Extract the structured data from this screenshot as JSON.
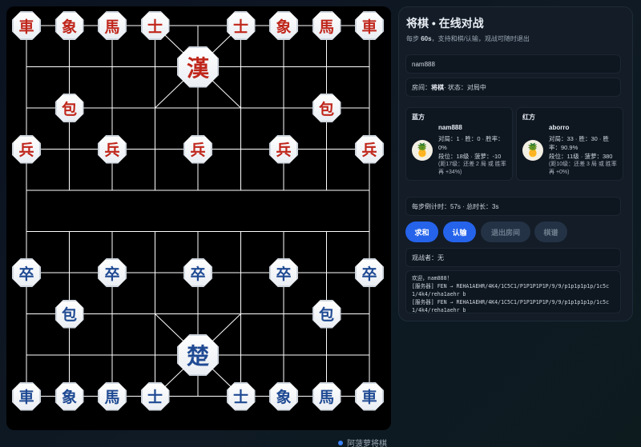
{
  "board": {
    "pieces": [
      {
        "char": "車",
        "color": "red",
        "col": 0,
        "row": 0
      },
      {
        "char": "象",
        "color": "red",
        "col": 1,
        "row": 0
      },
      {
        "char": "馬",
        "color": "red",
        "col": 2,
        "row": 0
      },
      {
        "char": "士",
        "color": "red",
        "col": 3,
        "row": 0
      },
      {
        "char": "士",
        "color": "red",
        "col": 5,
        "row": 0
      },
      {
        "char": "象",
        "color": "red",
        "col": 6,
        "row": 0
      },
      {
        "char": "馬",
        "color": "red",
        "col": 7,
        "row": 0
      },
      {
        "char": "車",
        "color": "red",
        "col": 8,
        "row": 0
      },
      {
        "char": "漢",
        "color": "red",
        "col": 4,
        "row": 1,
        "big": true
      },
      {
        "char": "包",
        "color": "red",
        "col": 1,
        "row": 2
      },
      {
        "char": "包",
        "color": "red",
        "col": 7,
        "row": 2
      },
      {
        "char": "兵",
        "color": "red",
        "col": 0,
        "row": 3
      },
      {
        "char": "兵",
        "color": "red",
        "col": 2,
        "row": 3
      },
      {
        "char": "兵",
        "color": "red",
        "col": 4,
        "row": 3
      },
      {
        "char": "兵",
        "color": "red",
        "col": 6,
        "row": 3
      },
      {
        "char": "兵",
        "color": "red",
        "col": 8,
        "row": 3
      },
      {
        "char": "卒",
        "color": "blue",
        "col": 0,
        "row": 6
      },
      {
        "char": "卒",
        "color": "blue",
        "col": 2,
        "row": 6
      },
      {
        "char": "卒",
        "color": "blue",
        "col": 4,
        "row": 6
      },
      {
        "char": "卒",
        "color": "blue",
        "col": 6,
        "row": 6
      },
      {
        "char": "卒",
        "color": "blue",
        "col": 8,
        "row": 6
      },
      {
        "char": "包",
        "color": "blue",
        "col": 1,
        "row": 7
      },
      {
        "char": "包",
        "color": "blue",
        "col": 7,
        "row": 7
      },
      {
        "char": "楚",
        "color": "blue",
        "col": 4,
        "row": 8,
        "big": true
      },
      {
        "char": "車",
        "color": "blue",
        "col": 0,
        "row": 9
      },
      {
        "char": "象",
        "color": "blue",
        "col": 1,
        "row": 9
      },
      {
        "char": "馬",
        "color": "blue",
        "col": 2,
        "row": 9
      },
      {
        "char": "士",
        "color": "blue",
        "col": 3,
        "row": 9
      },
      {
        "char": "士",
        "color": "blue",
        "col": 5,
        "row": 9
      },
      {
        "char": "象",
        "color": "blue",
        "col": 6,
        "row": 9
      },
      {
        "char": "馬",
        "color": "blue",
        "col": 7,
        "row": 9
      },
      {
        "char": "車",
        "color": "blue",
        "col": 8,
        "row": 9
      }
    ],
    "colors": {
      "red_piece": "#c0261b",
      "blue_piece": "#1f4a93",
      "line": "#ffffff",
      "background": "#000000"
    }
  },
  "brand": {
    "name": "阿菠萝将棋"
  },
  "panel": {
    "title": "将棋 • 在线对战",
    "subtitle_prefix": "每步",
    "subtitle_time": "60s",
    "subtitle_suffix": "，支持和棋/认输，观战可随时退出",
    "username": "nam888",
    "room": {
      "prefix": "房间：",
      "name": "将棋",
      "status": " · 状态：对局中"
    },
    "blue": {
      "side": "蓝方",
      "avatar_icon": "pineapple-icon",
      "name": "nam888",
      "stats": "对局：1 · 胜：0 · 胜率：0%",
      "rank": "段位：18级 · 菠萝：-10",
      "note": "(距17级：还差 2 局 或 胜率再 +34%)"
    },
    "red": {
      "side": "红方",
      "avatar_icon": "pineapple-icon",
      "name": "aborro",
      "stats": "对局：33 · 胜：30 · 胜率：90.9%",
      "rank": "段位：11级 · 菠萝：380",
      "note": "(距10级：还差 3 局 或 胜率再 +0%)"
    },
    "timer": "每步倒计时：57s · 总时长：3s",
    "buttons": {
      "draw": "求和",
      "resign": "认输",
      "leave": "退出房间",
      "record": "棋谱"
    },
    "spectators": "观战者：无",
    "log": [
      "欢迎，nam888！",
      "[服务器] FEN → REHA1AEHR/4K4/1C5C1/P1P1P1P1P/9/9/p1p1p1p1p/1c5c1/4k4/reha1aehr b",
      "[服务器] FEN → REHA1AEHR/4K4/1C5C1/P1P1P1P1P/9/9/p1p1p1p1p/1c5c1/4k4/reha1aehr b"
    ],
    "accent": "#2563eb"
  }
}
